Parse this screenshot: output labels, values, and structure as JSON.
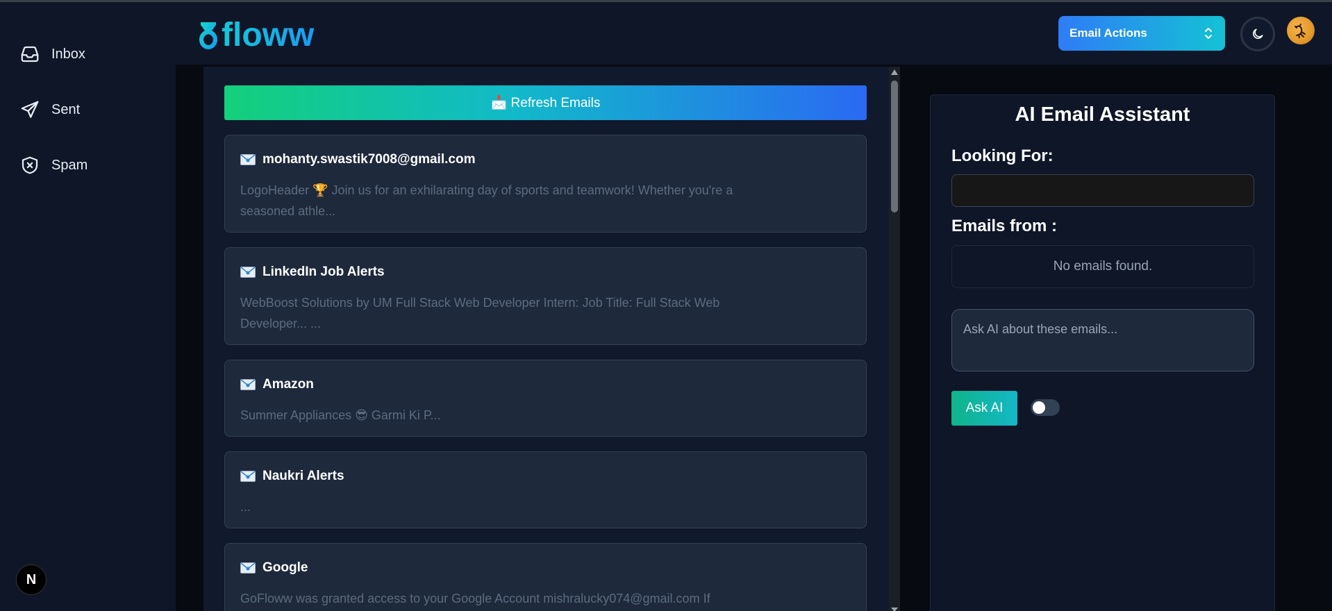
{
  "sidebar": {
    "items": [
      {
        "label": "Inbox",
        "icon": "inbox-icon"
      },
      {
        "label": "Sent",
        "icon": "send-icon"
      },
      {
        "label": "Spam",
        "icon": "spam-shield-icon"
      }
    ],
    "badge_letter": "N"
  },
  "header": {
    "logo_text": "floww",
    "email_actions_label": "Email Actions",
    "theme_icon": "moon-icon",
    "avatar_icon": "scorpion-avatar"
  },
  "emails": {
    "refresh_label": "📩 Refresh Emails",
    "list": [
      {
        "from": "mohanty.swastik7008@gmail.com",
        "preview": "LogoHeader 🏆  Join us for an exhilarating day of sports and teamwork! Whether you're a seasoned athle..."
      },
      {
        "from": "LinkedIn Job Alerts",
        "preview": "WebBoost Solutions by UM Full Stack Web Developer Intern: Job Title: Full Stack Web Developer...  ..."
      },
      {
        "from": "Amazon",
        "preview": "Summer Appliances 😎 Garmi Ki P..."
      },
      {
        "from": "Naukri Alerts",
        "preview": "..."
      },
      {
        "from": "Google",
        "preview": "GoFloww was granted access to your Google Account mishralucky074@gmail.com If"
      }
    ]
  },
  "ai": {
    "title": "AI Email Assistant",
    "looking_for_label": "Looking For:",
    "looking_for_value": "",
    "emails_from_label": "Emails from :",
    "no_emails_text": "No emails found.",
    "ask_placeholder": "Ask AI about these emails...",
    "ask_button_label": "Ask AI",
    "toggle_on": false
  },
  "colors": {
    "brand_cyan": "#12b8e8",
    "card_bg": "#1e293b",
    "panel_bg": "#0e1628"
  }
}
